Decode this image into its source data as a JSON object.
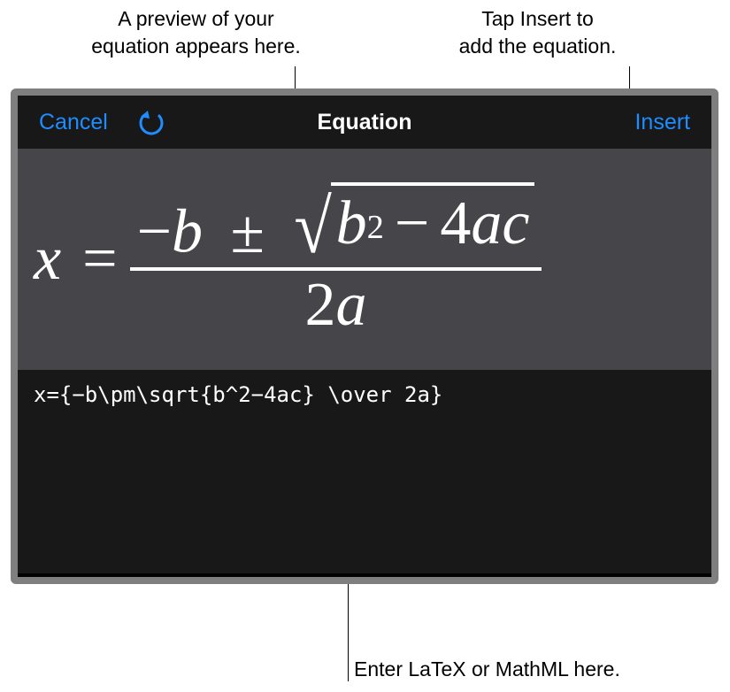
{
  "callouts": {
    "preview": "A preview of your\nequation appears here.",
    "insert": "Tap Insert to\nadd the equation.",
    "entry": "Enter LaTeX or MathML here."
  },
  "topbar": {
    "cancel_label": "Cancel",
    "title": "Equation",
    "insert_label": "Insert"
  },
  "equation_preview": {
    "lhs_var": "x",
    "eq": "=",
    "minus": "−",
    "var_b": "b",
    "pm": "±",
    "exp_2": "2",
    "four": "4",
    "var_a": "a",
    "var_c": "c",
    "two": "2"
  },
  "entry_text": "x={−b\\pm\\sqrt{b^2−4ac} \\over 2a}"
}
